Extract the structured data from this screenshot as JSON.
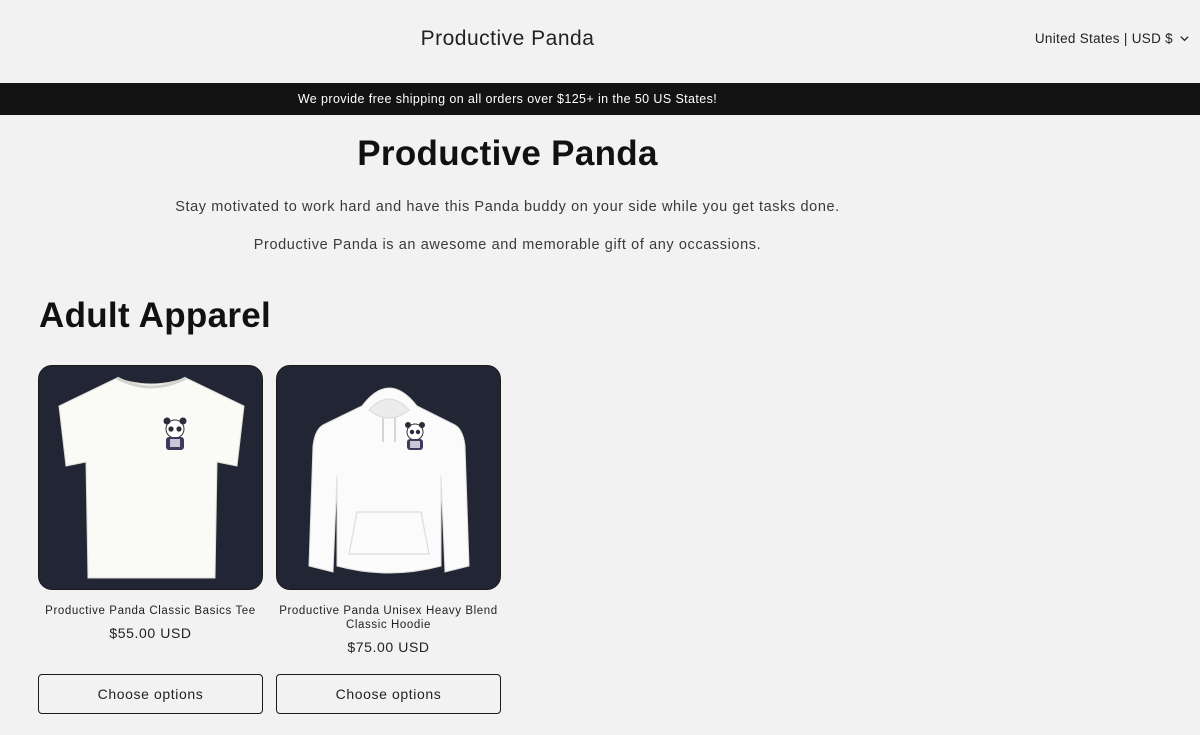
{
  "header": {
    "brand": "Productive Panda",
    "locale": "United States | USD $",
    "locale_icon": "chevron-down-icon"
  },
  "announcement": {
    "text": "We provide free shipping on all orders over $125+ in the 50 US States!"
  },
  "hero": {
    "title": "Productive Panda",
    "paragraphs": [
      "Stay motivated to work hard and have this Panda buddy on your side while you get tasks done.",
      "Productive Panda is an awesome and memorable gift of any occassions."
    ]
  },
  "collection": {
    "title": "Adult Apparel",
    "products": [
      {
        "title": "Productive Panda Classic Basics Tee",
        "price": "$55.00 USD",
        "button": "Choose options",
        "image": "white-tshirt-with-panda-print"
      },
      {
        "title": "Productive Panda Unisex Heavy Blend Classic Hoodie",
        "price": "$75.00 USD",
        "button": "Choose options",
        "image": "white-hoodie-with-panda-print"
      }
    ]
  },
  "colors": {
    "background": "#f2f2f2",
    "announcement_bar": "#131313",
    "card_background": "#222634",
    "text": "#1a1a1a"
  }
}
